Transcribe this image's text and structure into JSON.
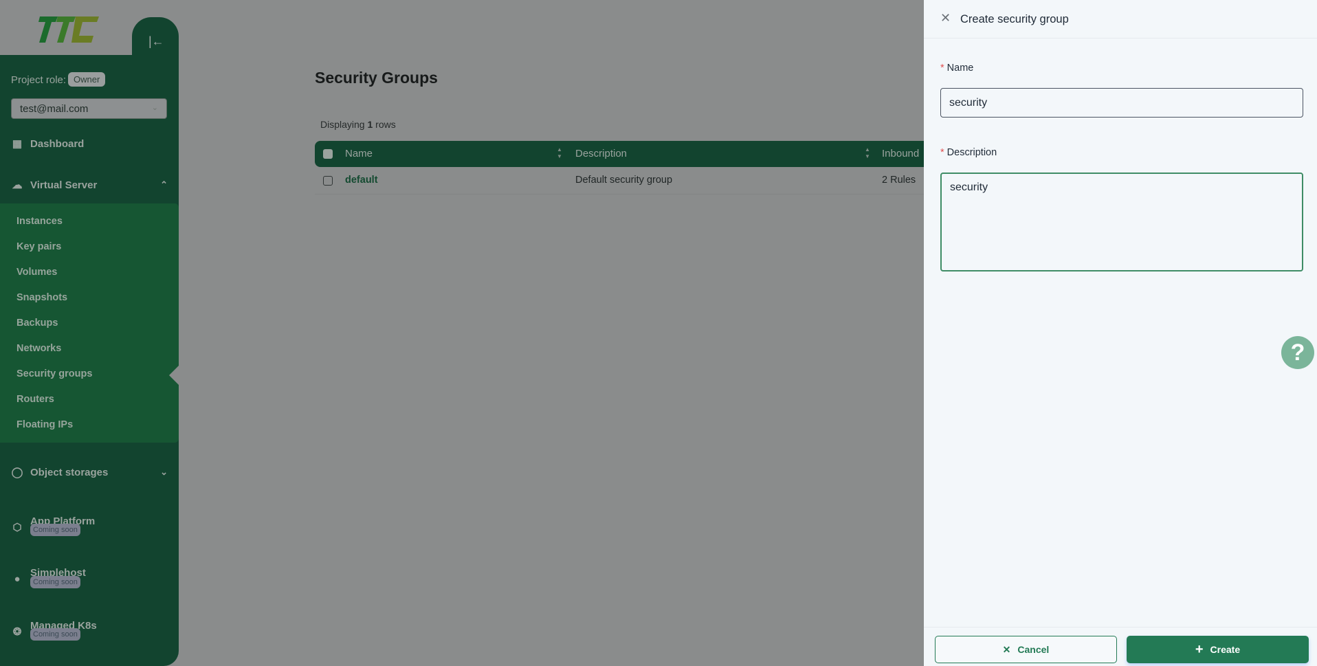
{
  "sidebar": {
    "logo_text": "TTC",
    "collapse_icon": "collapse-left-icon",
    "project_role_label": "Project role:",
    "project_role": "Owner",
    "account": "test@mail.com",
    "dashboard": "Dashboard",
    "virtual_server": "Virtual Server",
    "submenu": [
      "Instances",
      "Key pairs",
      "Volumes",
      "Snapshots",
      "Backups",
      "Networks",
      "Security groups",
      "Routers",
      "Floating IPs"
    ],
    "active_item": "Security groups",
    "object_storages": "Object storages",
    "app_platform": "App Platform",
    "simplehost": "Simplehost",
    "managed_k8s": "Managed K8s",
    "coming_soon": "Coming soon"
  },
  "main": {
    "title": "Security Groups",
    "displaying_prefix": "Displaying",
    "displaying_count": "1",
    "displaying_suffix": "rows",
    "columns": [
      "Name",
      "Description",
      "Inbound"
    ],
    "rows": [
      {
        "name": "default",
        "description": "Default security group",
        "inbound": "2 Rules"
      }
    ]
  },
  "drawer": {
    "title": "Create security group",
    "name_label": "Name",
    "name_value": "security",
    "description_label": "Description",
    "description_value": "security",
    "cancel": "Cancel",
    "create": "Create"
  },
  "colors": {
    "brand": "#237a55",
    "sidebar": "#1b6b45"
  }
}
